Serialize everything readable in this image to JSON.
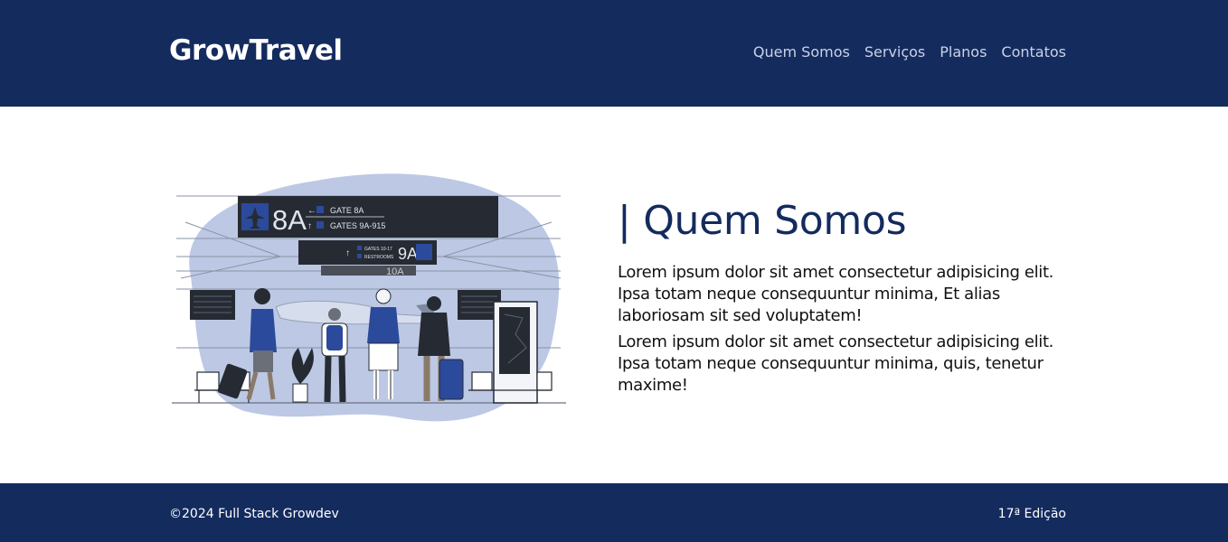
{
  "header": {
    "logo": "GrowTravel",
    "nav": [
      "Quem Somos",
      "Serviços",
      "Planos",
      "Contatos"
    ]
  },
  "illustration": {
    "board1": {
      "code": "8A",
      "line1": "GATE 8A",
      "line2": "GATES 9A-915"
    },
    "board2": {
      "code": "9A",
      "line1": "GATES 10-17",
      "line2": "RESTROOMS"
    },
    "board3": {
      "code": "10A"
    }
  },
  "about": {
    "title": "| Quem Somos",
    "paragraphs": [
      "Lorem ipsum dolor sit amet consectetur adipisicing elit. Ipsa totam neque consequuntur minima, Et alias laboriosam sit sed voluptatem!",
      "Lorem ipsum dolor sit amet consectetur adipisicing elit. Ipsa totam neque consequuntur minima, quis, tenetur maxime!"
    ]
  },
  "footer": {
    "copyright": "©2024 Full Stack Growdev",
    "edition": "17ª Edição"
  },
  "colors": {
    "primary": "#142b5e",
    "accent": "#2c4a9c",
    "blob": "#bcc8e4"
  }
}
